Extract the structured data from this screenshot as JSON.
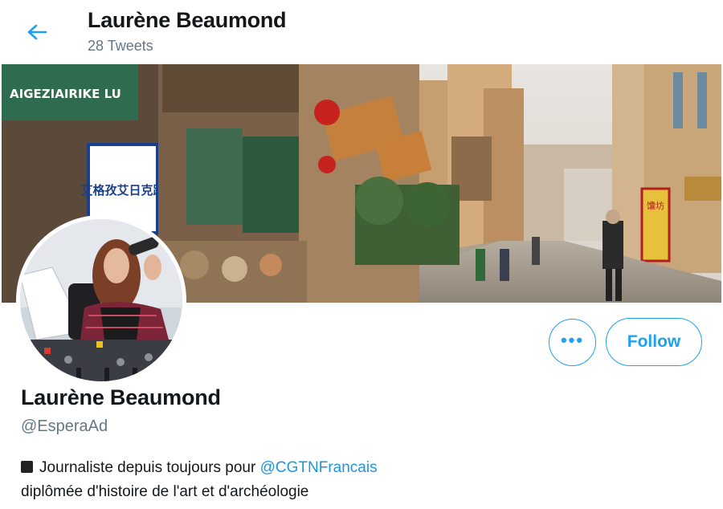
{
  "header": {
    "title": "Laurène Beaumond",
    "subtitle": "28 Tweets"
  },
  "banner": {
    "street_sign": "AIGEZIAIRIKE LU",
    "shop_sign": "艾格孜艾日克路",
    "banner_sign": "馕坊"
  },
  "actions": {
    "more_label": "•••",
    "follow_label": "Follow"
  },
  "profile": {
    "display_name": "Laurène Beaumond",
    "handle": "@EsperaAd",
    "bio_line1_prefix": "Journaliste depuis toujours pour ",
    "bio_mention": "@CGTNFrancais",
    "bio_line2": "diplômée d'histoire de l'art et d'archéologie"
  },
  "colors": {
    "accent": "#1da1f2",
    "link": "#1b95e0",
    "secondary_text": "#657786"
  }
}
